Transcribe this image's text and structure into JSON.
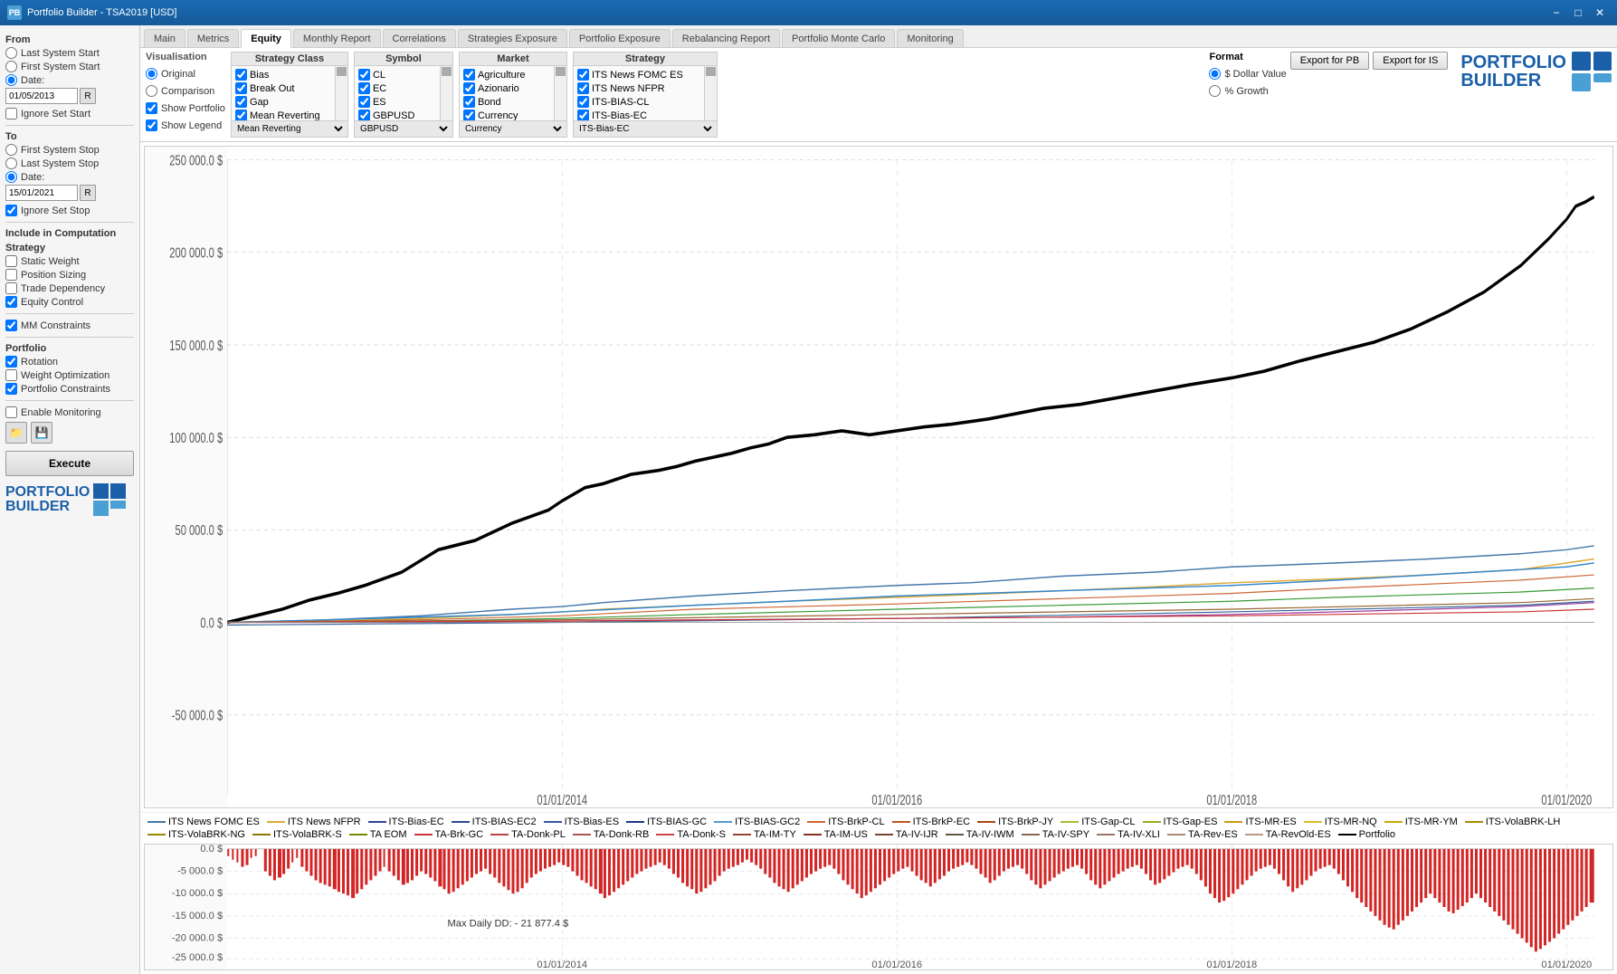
{
  "titlebar": {
    "title": "Portfolio Builder - TSA2019 [USD]",
    "icon": "PB"
  },
  "tabs": {
    "items": [
      "Main",
      "Metrics",
      "Equity",
      "Monthly Report",
      "Correlations",
      "Strategies Exposure",
      "Portfolio Exposure",
      "Rebalancing Report",
      "Portfolio Monte Carlo",
      "Monitoring"
    ],
    "active": "Equity"
  },
  "visualization": {
    "label": "Visualisation",
    "options": [
      "Original",
      "Comparison"
    ],
    "checkboxes": [
      {
        "label": "Show Portfolio",
        "checked": true
      },
      {
        "label": "Show Legend",
        "checked": true
      }
    ],
    "selected": "Original"
  },
  "strategy_class": {
    "title": "Strategy Class",
    "items": [
      {
        "label": "Bias",
        "checked": true
      },
      {
        "label": "Break Out",
        "checked": true
      },
      {
        "label": "Gap",
        "checked": true
      },
      {
        "label": "Mean Reverting",
        "checked": true
      }
    ]
  },
  "symbol": {
    "title": "Symbol",
    "items": [
      {
        "label": "CL",
        "checked": true
      },
      {
        "label": "EC",
        "checked": true
      },
      {
        "label": "ES",
        "checked": true
      },
      {
        "label": "GBPUSD",
        "checked": true
      }
    ]
  },
  "market": {
    "title": "Market",
    "items": [
      {
        "label": "Agriculture",
        "checked": true
      },
      {
        "label": "Azionario",
        "checked": true
      },
      {
        "label": "Bond",
        "checked": true
      },
      {
        "label": "Currency",
        "checked": true
      }
    ]
  },
  "strategy": {
    "title": "Strategy",
    "items": [
      {
        "label": "ITS News FOMC ES",
        "checked": true
      },
      {
        "label": "ITS News NFPR",
        "checked": true
      },
      {
        "label": "ITS-BIAS-CL",
        "checked": true
      },
      {
        "label": "ITS-Bias-EC",
        "checked": true
      }
    ]
  },
  "format": {
    "title": "Format",
    "options": [
      "$ Dollar Value",
      "% Growth"
    ],
    "selected": "$ Dollar Value"
  },
  "export": {
    "export_pb": "Export for PB",
    "export_is": "Export for IS"
  },
  "sidebar": {
    "from_label": "From",
    "from_options": [
      "Last System Start",
      "First System Start",
      "Date:"
    ],
    "from_date": "01/05/2013",
    "from_date_selected": true,
    "ignore_set_start": "Ignore Set Start",
    "to_label": "To",
    "to_options": [
      "First System Stop",
      "Last System Stop",
      "Date:"
    ],
    "to_date": "15/01/2021",
    "to_date_selected": true,
    "ignore_set_stop": "Ignore Set Stop",
    "include_label": "Include in Computation",
    "strategy_label": "Strategy",
    "strategy_items": [
      {
        "label": "Static Weight",
        "checked": false
      },
      {
        "label": "Position Sizing",
        "checked": false
      },
      {
        "label": "Trade Dependency",
        "checked": false
      },
      {
        "label": "Equity Control",
        "checked": true
      }
    ],
    "mm_label": "MM Constraints",
    "mm_checked": true,
    "portfolio_label": "Portfolio",
    "portfolio_items": [
      {
        "label": "Rotation",
        "checked": true
      },
      {
        "label": "Weight Optimization",
        "checked": false
      },
      {
        "label": "Portfolio Constraints",
        "checked": true
      }
    ],
    "enable_monitoring": "Enable Monitoring",
    "enable_monitoring_checked": false,
    "execute_btn": "Execute"
  },
  "chart": {
    "y_labels": [
      "250 000.0 $",
      "200 000.0 $",
      "150 000.0 $",
      "100 000.0 $",
      "50 000.0 $",
      "0.0 $",
      "-50 000.0 $"
    ],
    "x_labels": [
      "01/01/2014",
      "01/01/2016",
      "01/01/2018",
      "01/01/2020"
    ],
    "dd_y_labels": [
      "0.0 $",
      "-5 000.0 $",
      "-10 000.0 $",
      "-15 000.0 $",
      "-20 000.0 $",
      "-25 000.0 $"
    ],
    "dd_label": "Max Daily DD: - 21 877.4 $"
  },
  "legend": {
    "items": [
      {
        "label": "ITS News FOMC ES",
        "color": "#4477aa"
      },
      {
        "label": "ITS News NFPR",
        "color": "#ddaa33"
      },
      {
        "label": "ITS-Bias-EC",
        "color": "#3366cc"
      },
      {
        "label": "ITS-BIAS-EC2",
        "color": "#334499"
      },
      {
        "label": "ITS-Bias-ES",
        "color": "#334499"
      },
      {
        "label": "ITS-BIAS-GC",
        "color": "#223388"
      },
      {
        "label": "ITS-BIAS-GC2",
        "color": "#5599cc"
      },
      {
        "label": "ITS-BrkP-CL",
        "color": "#cc6633"
      },
      {
        "label": "ITS-BrkP-EC",
        "color": "#bb5522"
      },
      {
        "label": "ITS-BrkP-JY",
        "color": "#aa4411"
      },
      {
        "label": "ITS-Gap-CL",
        "color": "#aabb33"
      },
      {
        "label": "ITS-Gap-ES",
        "color": "#99aa22"
      },
      {
        "label": "ITS-MR-ES",
        "color": "#cc9911"
      },
      {
        "label": "ITS-MR-NQ",
        "color": "#ddbb22"
      },
      {
        "label": "ITS-MR-YM",
        "color": "#ccaa00"
      },
      {
        "label": "ITS-VolaBRK-LH",
        "color": "#aa8800"
      },
      {
        "label": "ITS-VolaBRK-NG",
        "color": "#998800"
      },
      {
        "label": "ITS-VolaBRK-S",
        "color": "#887700"
      },
      {
        "label": "TA EOM",
        "color": "#778800"
      },
      {
        "label": "TA-Brk-GC",
        "color": "#cc3333"
      },
      {
        "label": "TA-Donk-PL",
        "color": "#bb4444"
      },
      {
        "label": "TA-Donk-RB",
        "color": "#aa5555"
      },
      {
        "label": "TA-Donk-S",
        "color": "#cc4444"
      },
      {
        "label": "TA-IM-TY",
        "color": "#994433"
      },
      {
        "label": "TA-IM-US",
        "color": "#883322"
      },
      {
        "label": "TA-IV-IJR",
        "color": "#774433"
      },
      {
        "label": "TA-IV-IWM",
        "color": "#665544"
      },
      {
        "label": "TA-IV-SPY",
        "color": "#886655"
      },
      {
        "label": "TA-IV-XLI",
        "color": "#997766"
      },
      {
        "label": "TA-Rev-ES",
        "color": "#aa8877"
      },
      {
        "label": "TA-RevOld-ES",
        "color": "#bb9988"
      },
      {
        "label": "Portfolio",
        "color": "#000000"
      }
    ]
  }
}
